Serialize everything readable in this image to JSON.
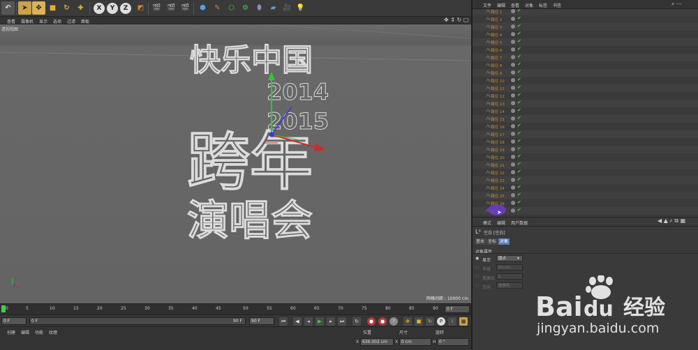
{
  "colors": {
    "selected": "#c9a24a",
    "object_name": "#d08a2a",
    "check_green": "#59c05a",
    "axis_y": "#2fc73a",
    "axis_x": "#d02a2a",
    "axis_z": "#3838e0",
    "highlight_purple": "#6a3dc9"
  },
  "toolbar": {
    "icons": [
      "undo-icon",
      "select-arrow-icon",
      "move-icon",
      "scale-icon",
      "rotate-icon",
      "plus-icon",
      "x-axis-icon",
      "y-axis-icon",
      "z-axis-icon",
      "coordinate-icon",
      "render-view-icon",
      "render-picture-icon",
      "render-settings-icon",
      "cube-icon",
      "pen-icon",
      "subdivision-icon",
      "gear-icon",
      "deformer-icon",
      "scene-icon",
      "camera-icon",
      "light-icon"
    ],
    "axis_labels": {
      "x": "X",
      "y": "Y",
      "z": "Z"
    }
  },
  "viewport": {
    "menu": [
      "查看",
      "摄像机",
      "显示",
      "选项",
      "过滤",
      "面板"
    ],
    "label": "透视视图",
    "hud": "网格间距 : 10000 cm",
    "artwork": {
      "line1": "快乐中国",
      "year1": "2014",
      "year2": "2015",
      "line3": "跨年",
      "line4": "演唱会"
    }
  },
  "timeline": {
    "ticks": [
      "0",
      "5",
      "10",
      "15",
      "20",
      "25",
      "30",
      "35",
      "40",
      "45",
      "50",
      "55",
      "60",
      "65",
      "70",
      "75",
      "80",
      "85",
      "90"
    ],
    "current_frame": "0 F"
  },
  "transport": {
    "start": "0 F",
    "range_start": "0 F",
    "range_end": "90 F",
    "end": "90 F"
  },
  "bottom": {
    "menu": [
      "创建",
      "编辑",
      "功能",
      "纹理"
    ],
    "coords": {
      "position": "位置",
      "size": "尺寸",
      "rotation": "旋转",
      "x_pos": "636.002 cm",
      "x_size": "0 cm",
      "h_rot": "0 °"
    }
  },
  "object_manager": {
    "menu": [
      "文件",
      "编辑",
      "查看",
      "对象",
      "标签",
      "书签"
    ],
    "items": [
      "路径 1",
      "路径 2",
      "路径 3",
      "路径 4",
      "路径 5",
      "路径 6",
      "路径 7",
      "路径 8",
      "路径 9",
      "路径 10",
      "路径 11",
      "路径 12",
      "路径 13",
      "路径 14",
      "路径 15",
      "路径 16",
      "路径 17",
      "路径 18",
      "路径 19",
      "路径 20",
      "路径 21",
      "路径 22",
      "路径 23",
      "路径 24",
      "路径 25",
      "路径 26",
      "路径 27",
      "路径 28",
      "路径 29",
      "路径 30",
      "路径 31"
    ]
  },
  "attributes": {
    "menu": [
      "模式",
      "编辑",
      "用户数据"
    ],
    "object_title": "空白 [空白]",
    "tabs": [
      "基本",
      "坐标",
      "对象"
    ],
    "section": "对象属性",
    "props": [
      {
        "label": "显示",
        "value": "圆点",
        "enabled": true
      },
      {
        "label": "半径",
        "value": "50 cm",
        "enabled": false
      },
      {
        "label": "宽高比",
        "value": "1",
        "enabled": false
      },
      {
        "label": "方向",
        "value": "摄像机",
        "enabled": false
      }
    ]
  },
  "watermark": {
    "brand_bai": "Bai",
    "brand_du": "du",
    "cn": "经验",
    "url": "jingyan.baidu.com"
  }
}
